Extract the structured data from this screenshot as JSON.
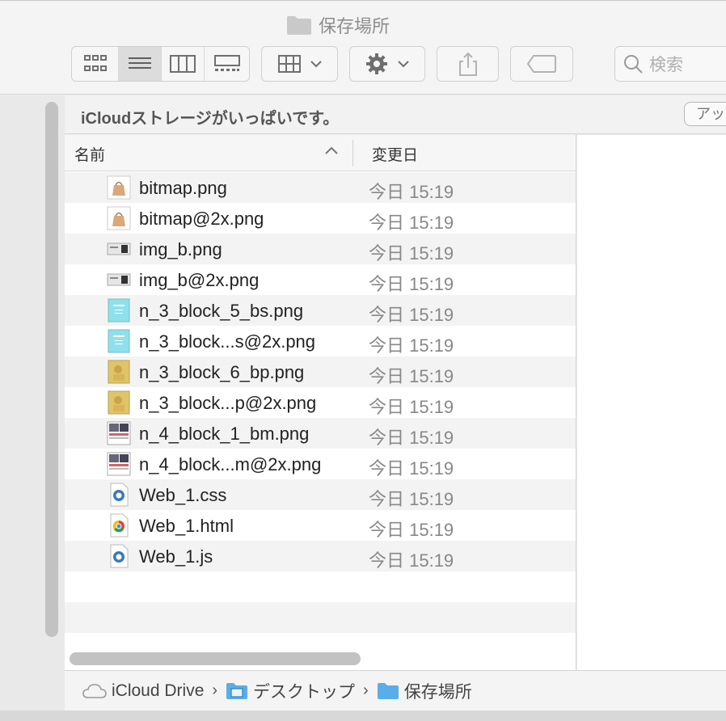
{
  "window": {
    "title": "保存場所",
    "title_icon": "folder-icon"
  },
  "toolbar": {
    "view_buttons": [
      "icon-view",
      "list-view",
      "column-view",
      "gallery-view"
    ],
    "active_view": "list-view",
    "group_button": "group-icon",
    "action_button": "gear-icon",
    "share_button": "share-icon",
    "tag_button": "tag-icon",
    "search_placeholder": "検索"
  },
  "banner": {
    "message": "iCloudストレージがいっぱいです。",
    "button_label": "アップグレード"
  },
  "list": {
    "columns": {
      "name": "名前",
      "date": "変更日"
    },
    "files": [
      {
        "name": "bitmap.png",
        "date": "今日 15:19",
        "icon": "bag-image-icon"
      },
      {
        "name": "bitmap@2x.png",
        "date": "今日 15:19",
        "icon": "bag-image-icon"
      },
      {
        "name": "img_b.png",
        "date": "今日 15:19",
        "icon": "banner-image-icon"
      },
      {
        "name": "img_b@2x.png",
        "date": "今日 15:19",
        "icon": "banner-image-icon"
      },
      {
        "name": "n_3_block_5_bs.png",
        "date": "今日 15:19",
        "icon": "cyan-image-icon"
      },
      {
        "name": "n_3_block...s@2x.png",
        "date": "今日 15:19",
        "icon": "cyan-image-icon"
      },
      {
        "name": "n_3_block_6_bp.png",
        "date": "今日 15:19",
        "icon": "gold-image-icon"
      },
      {
        "name": "n_3_block...p@2x.png",
        "date": "今日 15:19",
        "icon": "gold-image-icon"
      },
      {
        "name": "n_4_block_1_bm.png",
        "date": "今日 15:19",
        "icon": "photo-grid-image-icon"
      },
      {
        "name": "n_4_block...m@2x.png",
        "date": "今日 15:19",
        "icon": "photo-grid-image-icon"
      },
      {
        "name": "Web_1.css",
        "date": "今日 15:19",
        "icon": "css-file-icon"
      },
      {
        "name": "Web_1.html",
        "date": "今日 15:19",
        "icon": "chrome-html-file-icon"
      },
      {
        "name": "Web_1.js",
        "date": "今日 15:19",
        "icon": "js-file-icon"
      }
    ]
  },
  "pathbar": {
    "items": [
      {
        "label": "iCloud Drive",
        "icon": "cloud-icon"
      },
      {
        "label": "デスクトップ",
        "icon": "desktop-folder-icon"
      },
      {
        "label": "保存場所",
        "icon": "folder-icon"
      }
    ]
  },
  "colors": {
    "folder_blue": "#5aaee8",
    "toolbar_bg": "#f4f4f4",
    "row_alt": "#f3f3f3"
  }
}
